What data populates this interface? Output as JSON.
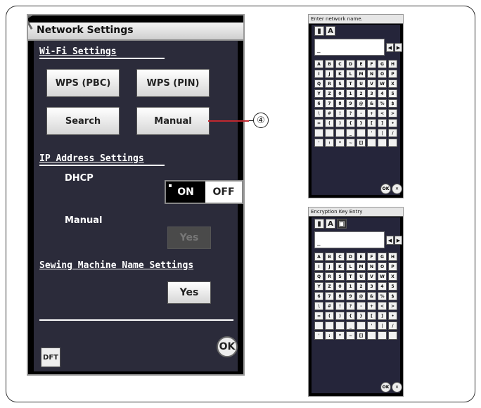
{
  "main": {
    "title": "Network Settings",
    "wifi_label": "Wi-Fi Settings",
    "btn_wps_pbc": "WPS (PBC)",
    "btn_wps_pin": "WPS (PIN)",
    "btn_search": "Search",
    "btn_manual": "Manual",
    "ip_label": "IP Address Settings",
    "dhcp_label": "DHCP",
    "dhcp_on": "ON",
    "dhcp_off": "OFF",
    "manual_label": "Manual",
    "manual_yes": "Yes",
    "machine_name_label": "Sewing Machine Name Settings",
    "machine_name_yes": "Yes",
    "dft_label": "DFT",
    "ok_label": "OK"
  },
  "callout_number": "④",
  "keyboard1": {
    "title": "Enter network name.",
    "field_value": "_",
    "ok_label": "OK"
  },
  "keyboard2": {
    "title": "Encryption Key Entry",
    "field_value": "_",
    "ok_label": "OK"
  },
  "keys": [
    "A",
    "B",
    "C",
    "D",
    "E",
    "F",
    "G",
    "H",
    "I",
    "J",
    "K",
    "L",
    "M",
    "N",
    "O",
    "P",
    "Q",
    "R",
    "S",
    "T",
    "U",
    "V",
    "W",
    "X",
    "Y",
    "Z",
    "0",
    "1",
    "2",
    "3",
    "4",
    "5",
    "6",
    "7",
    "8",
    "9",
    "@",
    "&",
    "%",
    "$",
    "\\",
    "#",
    "!",
    "?",
    "-",
    "+",
    "<",
    ">",
    "=",
    "(",
    ")",
    "{",
    "}",
    "[",
    "]",
    "•",
    "",
    "",
    "",
    "_",
    "",
    "'",
    "|",
    "/",
    "'",
    ":",
    "*",
    "~",
    "[]",
    "",
    "",
    ""
  ]
}
